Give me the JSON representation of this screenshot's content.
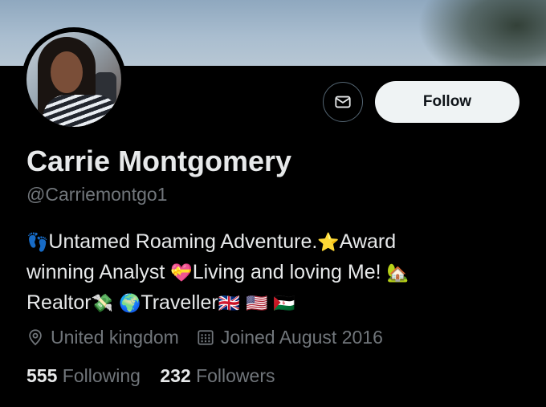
{
  "profile": {
    "name": "Carrie Montgomery",
    "handle": "@Carriemontgo1",
    "bio": {
      "line1": {
        "e1": "👣",
        "t1": "Untamed Roaming Adventure.",
        "e2": "⭐",
        "t2": "Award"
      },
      "line2": {
        "t1": "winning Analyst ",
        "e1": "💝",
        "t2": "Living and loving Me! ",
        "e2": "🏡"
      },
      "line3": {
        "t1": "Realtor",
        "e1": "💸",
        "e2": "🌍",
        "t2": "Traveller",
        "f1": "🇬🇧",
        "f2": "🇺🇸",
        "f3": "🇪🇭"
      }
    },
    "location": "United kingdom",
    "joined": "Joined August 2016",
    "following_count": "555",
    "following_label": "Following",
    "followers_count": "232",
    "followers_label": "Followers"
  },
  "actions": {
    "follow_label": "Follow",
    "message_icon": "envelope-icon"
  },
  "icons": {
    "location": "location-pin-icon",
    "calendar": "calendar-icon"
  },
  "colors": {
    "background": "#000000",
    "primary_text": "#e7e9ea",
    "secondary_text": "#71767b",
    "follow_button_bg": "#eff3f4",
    "border": "#536471"
  }
}
